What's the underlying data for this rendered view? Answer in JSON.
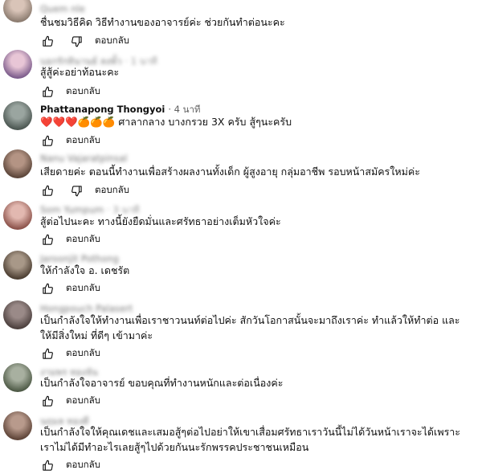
{
  "reply_label": "ตอบกลับ",
  "comments": [
    {
      "author": "Quem nle",
      "time": "",
      "text": "ชื่นชมวิธีคิด วิธีทำงานของอาจารย์ค่ะ ช่วยกันทำต่อนะคะ",
      "has_dislike": true,
      "avatar_colors": [
        "#d9c4b8",
        "#8a7a6e"
      ]
    },
    {
      "author": "บอกรักทินานธ์ ลงพั้ว",
      "time": "1 นาที",
      "text": "สู้สู้ค่ะอย่าท้อนะคะ",
      "has_dislike": false,
      "avatar_colors": [
        "#e8c6d6",
        "#7a5a8a"
      ]
    },
    {
      "author": "Phattanapong Thongyoi",
      "time": "4 นาที",
      "text": "❤️❤️❤️🍊🍊🍊 ศาลากลาง บางกรวย 3X ครับ สู้ๆนะครับ",
      "has_dislike": false,
      "avatar_colors": [
        "#9aa5a0",
        "#4a5550"
      ]
    },
    {
      "author": "Nanu Vajaratpinsal",
      "time": "",
      "text": "เสียดายค่ะ ตอนนี้ทำงานเพื่อสร้างผลงานทั้งเด็ก ผู้สูงอายุ กลุ่มอาชีพ รอบหน้าสมัครใหม่ค่ะ",
      "has_dislike": true,
      "avatar_colors": [
        "#b49484",
        "#5a4438"
      ]
    },
    {
      "author": "Som Yumpum",
      "time": "3 นาที",
      "text": "สู้ต่อไปนะคะ ทางนี้ยังยืดมั่นและศรัทธาอย่างเต็มหัวใจค่ะ",
      "has_dislike": false,
      "avatar_colors": [
        "#e2b8b0",
        "#8a5048"
      ]
    },
    {
      "author": "Jaroonjit Pothong",
      "time": "",
      "text": "ให้กำลังใจ อ. เดชรัต",
      "has_dislike": false,
      "avatar_colors": [
        "#a89888",
        "#4a3c30"
      ]
    },
    {
      "author": "Hongpouch Palasert",
      "time": "",
      "text": "เป็นกำลังใจให้ทำงานเพื่อเราชาวนนท์ต่อไปค่ะ สักวันโอกาสนั้นจะมาถึงเราค่ะ ทำแล้วให้ทำต่อ และให้มีสิ่งใหม่ ที่ดีๆ เข้ามาค่ะ",
      "has_dislike": false,
      "avatar_colors": [
        "#9a8a88",
        "#4a3e3c"
      ]
    },
    {
      "author": "งามพร ทองจัน",
      "time": "",
      "text": "เป็นกำลังใจอาจารย์ ขอบคุณที่ทำงานหนักและต่อเนื่องค่ะ",
      "has_dislike": false,
      "avatar_colors": [
        "#a8b0a0",
        "#4c5844"
      ]
    },
    {
      "author": "นฤมล ทองดี",
      "time": "",
      "text": "เป็นกำลังใจให้คุณเดชและเสมอสู้ๆต่อไปอย่าให้เขาเสื่อมศรัทธาเราวันนี้ไม่ได้วันหน้าเราจะได้เพราะเราไม่ได้มีทำอะไรเลยสู้ๆไปด้วยกันนะรักพรรคประชาชนเหมือน",
      "has_dislike": false,
      "avatar_colors": [
        "#b89a8c",
        "#5c4236"
      ]
    }
  ]
}
